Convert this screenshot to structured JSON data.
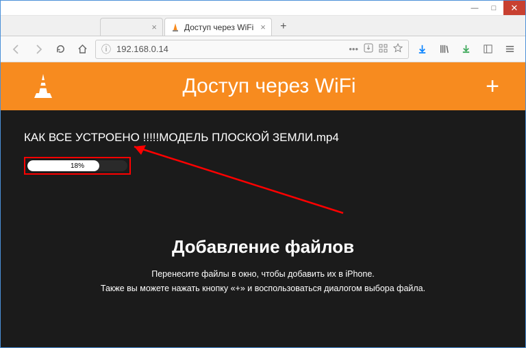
{
  "window": {
    "min": "—",
    "max": "□",
    "close": "✕"
  },
  "tabs": {
    "inactive_close": "×",
    "active_label": "Доступ через WiFi",
    "active_close": "×",
    "new_tab": "+"
  },
  "toolbar": {
    "url": "192.168.0.14",
    "dots": "•••"
  },
  "page": {
    "title": "Доступ через WiFi",
    "add": "+",
    "file_name": "КАК ВСЕ УСТРОЕНО !!!!!МОДЕЛЬ ПЛОСКОЙ ЗЕМЛИ.mp4",
    "progress_pct": "18%",
    "heading": "Добавление файлов",
    "line1": "Перенесите файлы в окно, чтобы добавить их в iPhone.",
    "line2": "Также вы можете нажать кнопку «+» и воспользоваться диалогом выбора файла."
  }
}
